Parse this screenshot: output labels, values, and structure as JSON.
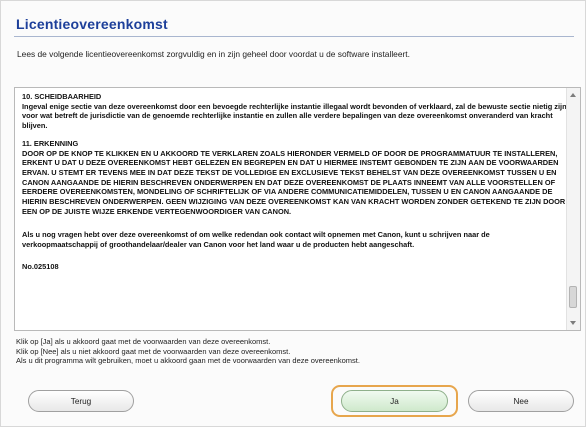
{
  "window": {
    "title": "Licentieovereenkomst"
  },
  "intro": "Lees de volgende licentieovereenkomst zorgvuldig en in zijn geheel door voordat u de software installeert.",
  "license": {
    "section10_heading": "10.  SCHEIDBAARHEID",
    "section10_body": "Ingeval enige sectie van deze overeenkomst door een bevoegde rechterlijke instantie illegaal wordt bevonden of verklaard, zal de bewuste sectie nietig zijn voor wat betreft de jurisdictie van de genoemde rechterlijke instantie en zullen alle verdere bepalingen van deze overeenkomst onveranderd van kracht blijven.",
    "section11_heading": "11.  ERKENNING",
    "section11_body": "DOOR OP DE KNOP TE KLIKKEN EN U AKKOORD TE VERKLAREN ZOALS HIERONDER VERMELD OF DOOR DE PROGRAMMATUUR TE INSTALLEREN, ERKENT U DAT U DEZE OVEREENKOMST HEBT GELEZEN EN BEGREPEN EN DAT U HIERMEE INSTEMT GEBONDEN TE ZIJN AAN DE VOORWAARDEN ERVAN.  U STEMT ER TEVENS MEE IN DAT DEZE TEKST DE VOLLEDIGE EN EXCLUSIEVE TEKST BEHELST VAN DEZE OVEREENKOMST TUSSEN U EN CANON AANGAANDE DE HIERIN BESCHREVEN ONDERWERPEN EN DAT DEZE OVEREENKOMST DE PLAATS INNEEMT VAN ALLE VOORSTELLEN OF EERDERE OVEREENKOMSTEN, MONDELING OF SCHRIFTELIJK OF VIA ANDERE COMMUNICATIEMIDDELEN, TUSSEN U EN CANON AANGAANDE DE HIERIN BESCHREVEN ONDERWERPEN.  GEEN WIJZIGING VAN DEZE OVEREENKOMST KAN VAN KRACHT WORDEN ZONDER GETEKEND TE ZIJN DOOR EEN OP DE JUISTE WIJZE ERKENDE VERTEGENWOORDIGER VAN CANON.",
    "contact": "Als u nog vragen hebt over deze overeenkomst of om welke redendan ook contact wilt opnemen met Canon, kunt u schrijven naar de verkoopmaatschappij of groothandelaar/dealer van Canon voor het land waar u de producten hebt aangeschaft.",
    "number": "No.025108"
  },
  "instructions": {
    "line1": "Klik op [Ja] als u akkoord gaat met de voorwaarden van deze overeenkomst.",
    "line2": "Klik op [Nee] als u niet akkoord gaat met de voorwaarden van deze overeenkomst.",
    "line3": "Als u dit programma wilt gebruiken, moet u akkoord gaan met de voorwaarden van deze overeenkomst."
  },
  "buttons": {
    "back": "Terug",
    "yes": "Ja",
    "no": "Nee"
  },
  "colors": {
    "title": "#1d3f9a",
    "focus_ring": "#e7a64d",
    "yes_button": "#cfe9cc"
  }
}
